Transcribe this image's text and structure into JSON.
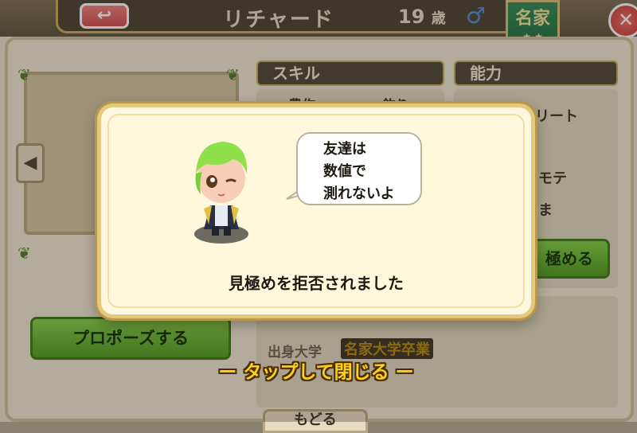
{
  "header": {
    "back_label": "↩",
    "name": "リチャード",
    "age": "19",
    "age_unit": "歳",
    "gender_symbol": "♂",
    "rank_badge": "名家",
    "rank_stars": "★ ★",
    "close_symbol": "✕"
  },
  "sections": {
    "skill_title": "スキル",
    "ability_title": "能力",
    "skills_visible": [
      "農作",
      "釣り"
    ],
    "abilities_visible": [
      "リート",
      "モテ",
      "ま"
    ]
  },
  "buttons": {
    "assess_label": "極める",
    "propose_label": "プロポーズする",
    "bottom_tab_label": "もどる"
  },
  "profile": {
    "university_label": "出身大学",
    "university_value": "名家大学卒業"
  },
  "modal": {
    "speech_lines": [
      "友達は",
      "数値で",
      "測れないよ"
    ],
    "message": "見極めを拒否されました",
    "tap_to_close": "ー タップして閉じる ー"
  },
  "colors": {
    "accent_green": "#5aaa2a",
    "gold_text": "#ffcf1a",
    "header_dark": "#4a4233",
    "avatar_hair": "#8fe04a"
  }
}
